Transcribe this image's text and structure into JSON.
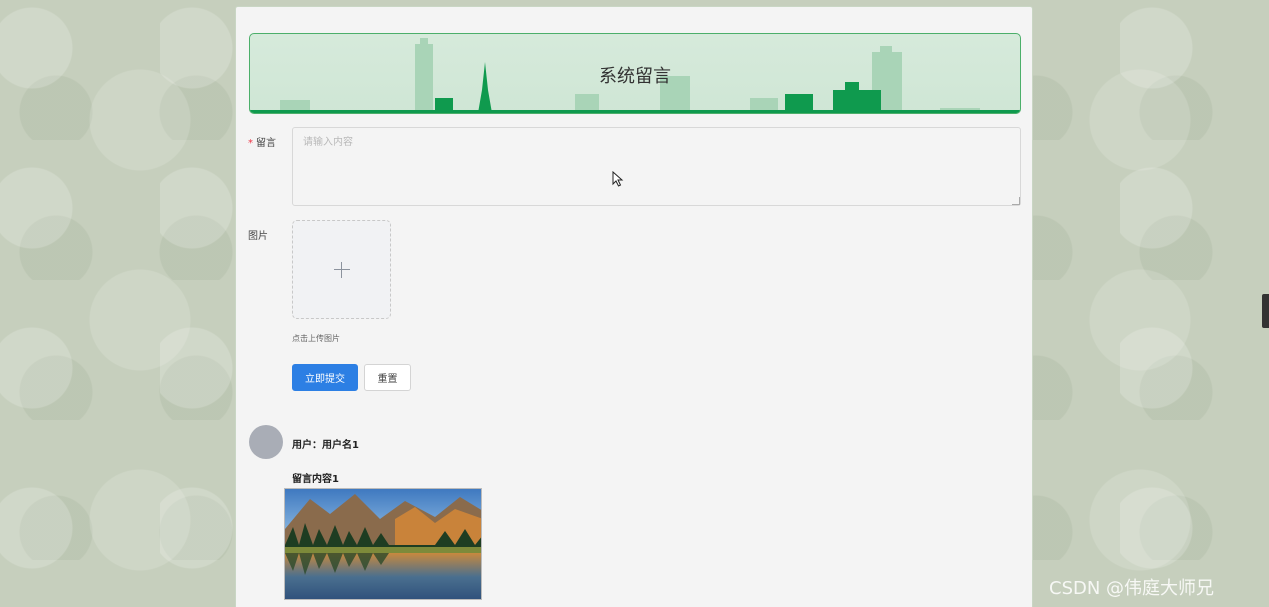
{
  "banner": {
    "title": "系统留言"
  },
  "form": {
    "message_label": "留言",
    "message_required_mark": "*",
    "message_placeholder": "请输入内容",
    "image_label": "图片",
    "upload_hint": "点击上传图片",
    "submit_label": "立即提交",
    "reset_label": "重置"
  },
  "comments": [
    {
      "user_line": "用户：用户名1",
      "content": "留言内容1"
    }
  ],
  "watermark": "CSDN @伟庭大师兄",
  "colors": {
    "accent": "#2c7fe4",
    "banner_green": "#0f9a4e",
    "page_bg": "#c6cfbd"
  },
  "icons": {
    "upload": "plus-icon",
    "cursor": "mouse-pointer-icon"
  }
}
